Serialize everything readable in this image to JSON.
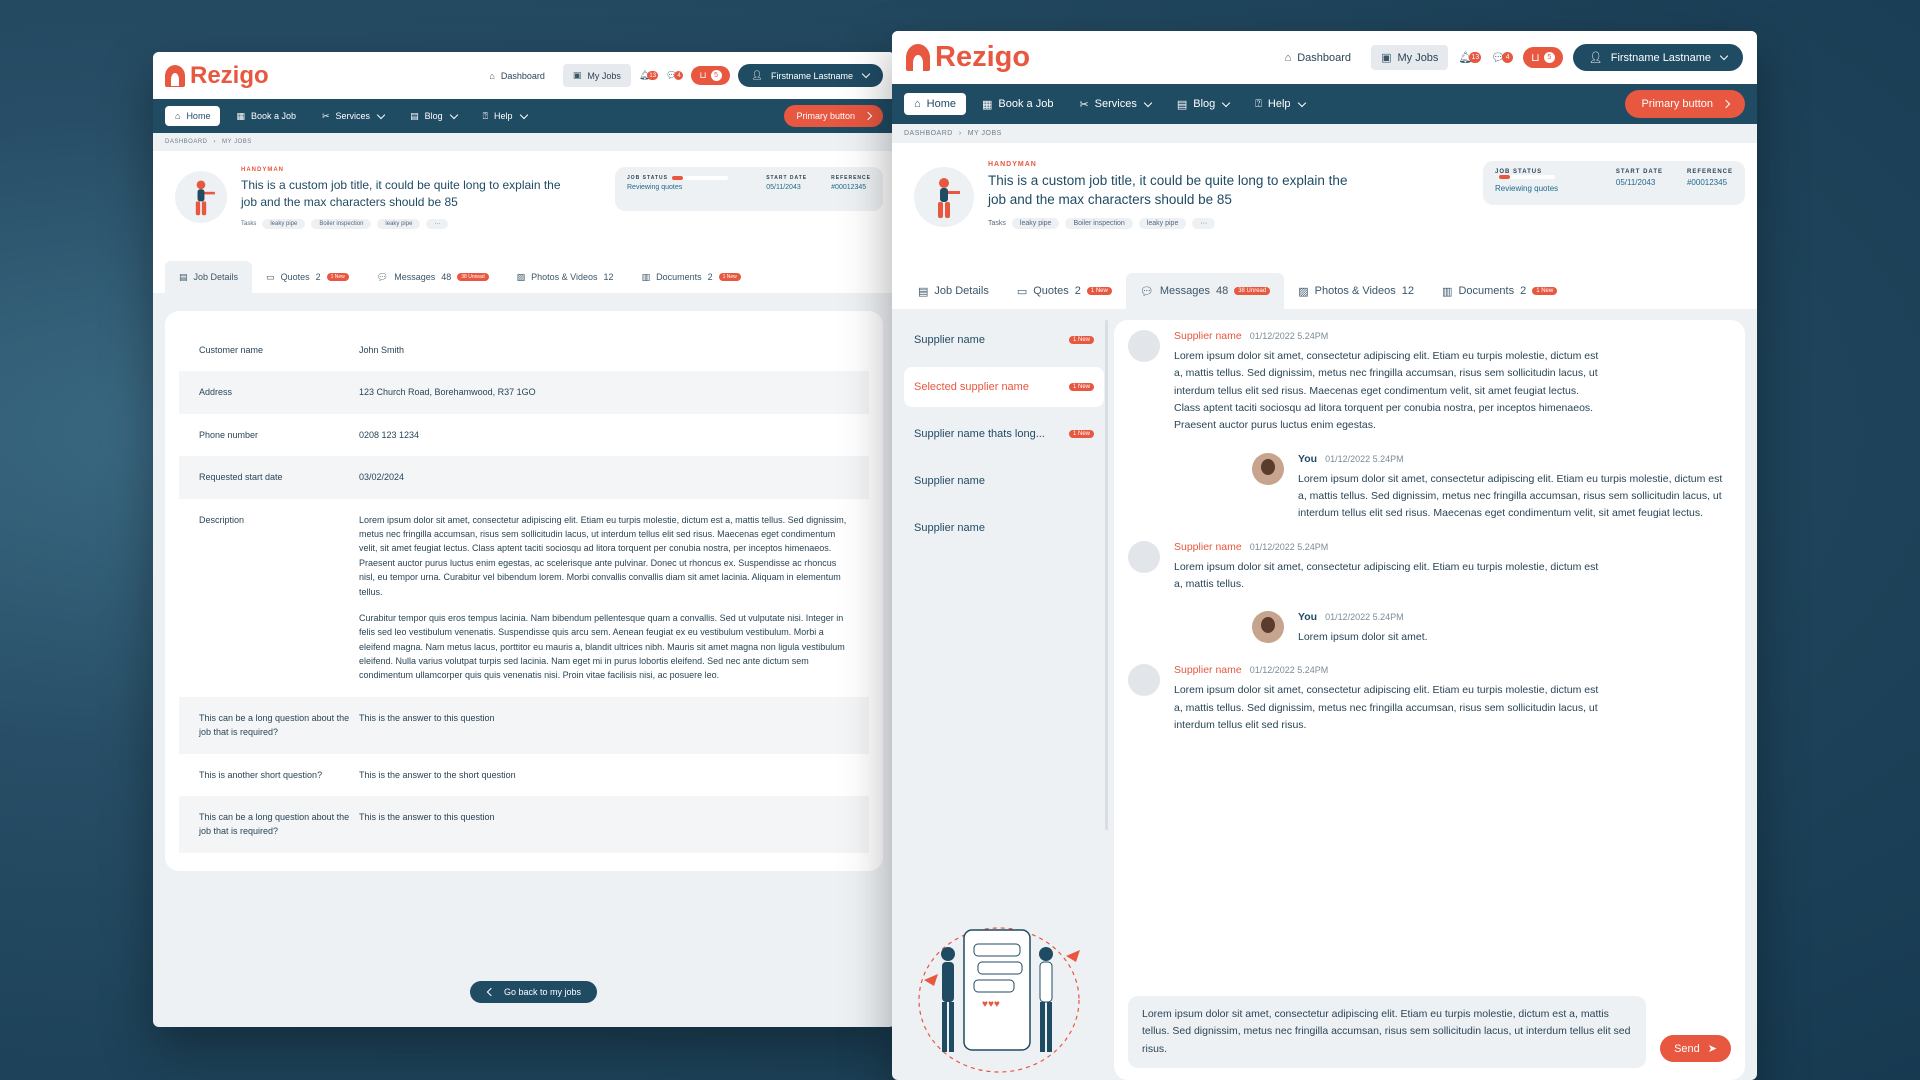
{
  "brand": {
    "name": "Rezigo",
    "accent": "#e8573f",
    "navy": "#1f4b63"
  },
  "topbar": {
    "dashboard": "Dashboard",
    "my_jobs": "My Jobs",
    "notif_count": "13",
    "msg_count": "4",
    "cart_count": "5",
    "user": "Firstname Lastname"
  },
  "nav": {
    "items": [
      "Home",
      "Book a Job",
      "Services",
      "Blog",
      "Help"
    ],
    "primary": "Primary button"
  },
  "crumbs": [
    "DASHBOARD",
    "MY JOBS"
  ],
  "job": {
    "category": "HANDYMAN",
    "title": "This is a custom job title, it could be quite long to explain the job and the max characters should be 85",
    "tasks_label": "Tasks",
    "tasks": [
      "leaky pipe",
      "Boiler inspection",
      "leaky pipe"
    ],
    "more": "···",
    "status_label": "JOB STATUS",
    "status": "Reviewing quotes",
    "progress": 0.2,
    "start_label": "START DATE",
    "start": "05/11/2043",
    "ref_label": "REFERENCE",
    "ref": "#00012345"
  },
  "tabs": [
    {
      "label": "Job Details",
      "count": "",
      "new": ""
    },
    {
      "label": "Quotes",
      "count": "2",
      "new": "1 New"
    },
    {
      "label": "Messages",
      "count": "48",
      "new": "38 Unread"
    },
    {
      "label": "Photos & Videos",
      "count": "12",
      "new": ""
    },
    {
      "label": "Documents",
      "count": "2",
      "new": "1 New"
    }
  ],
  "details": [
    {
      "k": "Customer name",
      "v": "John Smith"
    },
    {
      "k": "Address",
      "v": "123 Church Road, Borehamwood, R37 1GO"
    },
    {
      "k": "Phone number",
      "v": "0208 123 1234"
    },
    {
      "k": "Requested start date",
      "v": "03/02/2024"
    },
    {
      "k": "Description",
      "v": "Lorem ipsum dolor sit amet, consectetur adipiscing elit. Etiam eu turpis molestie, dictum est a, mattis tellus. Sed dignissim, metus nec fringilla accumsan, risus sem sollicitudin lacus, ut interdum tellus elit sed risus. Maecenas eget condimentum velit, sit amet feugiat lectus. Class aptent taciti sociosqu ad litora torquent per conubia nostra, per inceptos himenaeos. Praesent auctor purus luctus enim egestas, ac scelerisque ante pulvinar. Donec ut rhoncus ex. Suspendisse ac rhoncus nisl, eu tempor urna. Curabitur vel bibendum lorem. Morbi convallis convallis diam sit amet lacinia. Aliquam in elementum tellus.",
      "v2": "Curabitur tempor quis eros tempus lacinia. Nam bibendum pellentesque quam a convallis. Sed ut vulputate nisi. Integer in felis sed leo vestibulum venenatis. Suspendisse quis arcu sem. Aenean feugiat ex eu vestibulum vestibulum. Morbi a eleifend magna. Nam metus lacus, porttitor eu mauris a, blandit ultrices nibh. Mauris sit amet magna non ligula vestibulum eleifend. Nulla varius volutpat turpis sed lacinia. Nam eget mi in purus lobortis eleifend. Sed nec ante dictum sem condimentum ullamcorper quis quis venenatis nisi. Proin vitae facilisis nisi, ac posuere leo."
    },
    {
      "k": "This can be a long question about the job that is required?",
      "v": "This is the answer to this question"
    },
    {
      "k": "This is another short question?",
      "v": "This is the answer to the short question"
    },
    {
      "k": "This can be a long question about the job that is required?",
      "v": "This is the answer to this question"
    }
  ],
  "back_label": "Go back to my jobs",
  "suppliers": [
    {
      "name": "Supplier name",
      "new": "1 New"
    },
    {
      "name": "Selected supplier name",
      "new": "1 New"
    },
    {
      "name": "Supplier name thats long...",
      "new": "1 New"
    },
    {
      "name": "Supplier name",
      "new": ""
    },
    {
      "name": "Supplier name",
      "new": ""
    }
  ],
  "messages": [
    {
      "who": "Supplier name",
      "time": "01/12/2022 5.24PM",
      "text": "Lorem ipsum dolor sit amet, consectetur adipiscing elit. Etiam eu turpis molestie, dictum est a, mattis tellus. Sed dignissim, metus nec fringilla accumsan, risus sem sollicitudin lacus, ut interdum tellus elit sed risus. Maecenas eget condimentum velit, sit amet feugiat lectus. Class aptent taciti sociosqu ad litora torquent per conubia nostra, per inceptos himenaeos. Praesent auctor purus luctus enim egestas."
    },
    {
      "who": "You",
      "time": "01/12/2022 5.24PM",
      "text": "Lorem ipsum dolor sit amet, consectetur adipiscing elit. Etiam eu turpis molestie, dictum est a, mattis tellus. Sed dignissim, metus nec fringilla accumsan, risus sem sollicitudin lacus, ut interdum tellus elit sed risus. Maecenas eget condimentum velit, sit amet feugiat lectus."
    },
    {
      "who": "Supplier name",
      "time": "01/12/2022 5.24PM",
      "text": "Lorem ipsum dolor sit amet, consectetur adipiscing elit. Etiam eu turpis molestie, dictum est a, mattis tellus."
    },
    {
      "who": "You",
      "time": "01/12/2022 5.24PM",
      "text": "Lorem ipsum dolor sit amet."
    },
    {
      "who": "Supplier name",
      "time": "01/12/2022 5.24PM",
      "text": "Lorem ipsum dolor sit amet, consectetur adipiscing elit. Etiam eu turpis molestie, dictum est a, mattis tellus. Sed dignissim, metus nec fringilla accumsan, risus sem sollicitudin lacus, ut interdum tellus elit sed risus."
    }
  ],
  "compose": "Lorem ipsum dolor sit amet, consectetur adipiscing elit. Etiam eu turpis molestie, dictum est a, mattis tellus. Sed dignissim, metus nec fringilla accumsan, risus sem sollicitudin lacus, ut interdum tellus elit sed risus.",
  "send_label": "Send"
}
